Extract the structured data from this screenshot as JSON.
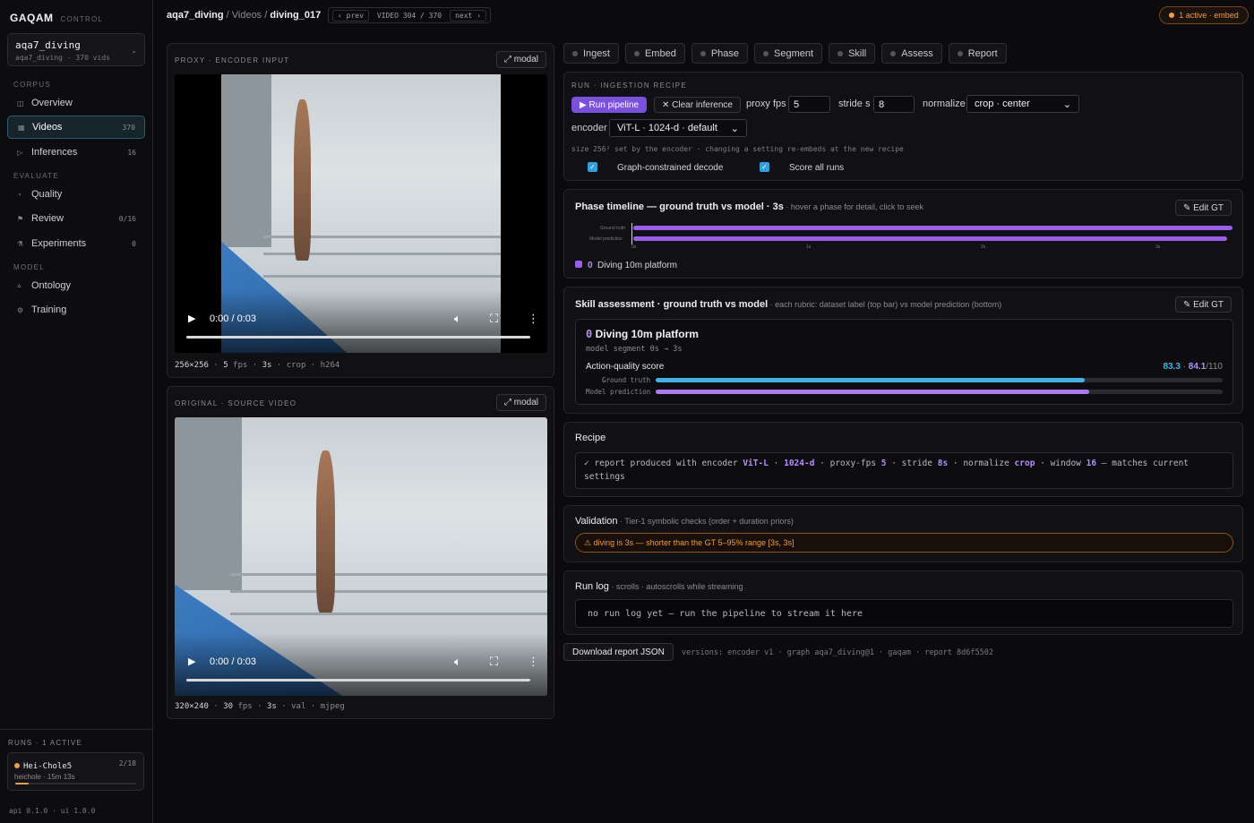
{
  "brand": {
    "name": "GAQAM",
    "sub": "CONTROL"
  },
  "dataset": {
    "name": "aqa7_diving",
    "meta": "aqa7_diving · 370 vids",
    "caret": "⌄"
  },
  "nav": {
    "corpus_label": "CORPUS",
    "evaluate_label": "EVALUATE",
    "model_label": "MODEL",
    "overview": {
      "label": "Overview",
      "icon": "◫"
    },
    "videos": {
      "label": "Videos",
      "count": "370",
      "icon": "▦"
    },
    "inferences": {
      "label": "Inferences",
      "count": "16",
      "icon": "▷"
    },
    "quality": {
      "label": "Quality",
      "icon": "◔"
    },
    "review": {
      "label": "Review",
      "count": "0/16",
      "icon": "⚑"
    },
    "experiments": {
      "label": "Experiments",
      "count": "0",
      "icon": "⚗"
    },
    "ontology": {
      "label": "Ontology",
      "icon": "⟑"
    },
    "training": {
      "label": "Training",
      "icon": "⚙"
    }
  },
  "runs": {
    "header": "RUNS · 1 ACTIVE",
    "item": {
      "name": "Hei-Chole5",
      "count": "2/18",
      "sub": "heichole · 15m 13s",
      "progress": 0.11
    }
  },
  "api_version": "api 0.1.0 · ui 1.0.0",
  "breadcrumb": {
    "dataset": "aqa7_diving",
    "sep1": " / ",
    "section": "Videos",
    "sep2": " / ",
    "item": "diving_017"
  },
  "video_nav": {
    "prev": "‹ prev",
    "position": "VIDEO 304 / 370",
    "next": "next ›"
  },
  "active_badge": "1 active · embed",
  "proxy_panel": {
    "label": "PROXY · ENCODER INPUT",
    "modal_label": "⤢ modal",
    "time": "0:00 / 0:03",
    "meta": {
      "res": "256×256",
      "fps": "5",
      "fps_unit": "fps",
      "dur": "3s",
      "mode": "crop",
      "codec": "h264"
    }
  },
  "source_panel": {
    "label": "ORIGINAL · SOURCE VIDEO",
    "modal_label": "⤢ modal",
    "time": "0:00 / 0:03",
    "meta": {
      "res": "320×240",
      "fps": "30",
      "fps_unit": "fps",
      "dur": "3s",
      "split": "val",
      "codec": "mjpeg"
    }
  },
  "tabs": [
    "Ingest",
    "Embed",
    "Phase",
    "Segment",
    "Skill",
    "Assess",
    "Report"
  ],
  "run": {
    "label": "RUN · INGESTION RECIPE",
    "run_button": "▶ Run pipeline",
    "clear_button": "✕ Clear inference",
    "proxy_fps_label": "proxy fps",
    "proxy_fps_value": "5",
    "stride_label": "stride s",
    "stride_value": "8",
    "normalize_label": "normalize",
    "normalize_value": "crop · center",
    "encoder_label": "encoder",
    "encoder_value": "ViT-L · 1024-d · default",
    "hint": "size 256² set by the encoder · changing a setting re-embeds at the new recipe",
    "graph_decode_label": "Graph-constrained decode",
    "score_all_label": "Score all runs"
  },
  "phase": {
    "title": "Phase timeline — ground truth vs model · 3s",
    "subtitle": " · hover a phase for detail, click to seek",
    "edit_label": "✎ Edit GT",
    "gt_label": "Ground truth",
    "model_label": "Model prediction",
    "ticks": [
      "0s",
      "1s",
      "2s",
      "3s"
    ],
    "legend_id": "0",
    "legend_label": "Diving 10m platform"
  },
  "skill": {
    "title": "Skill assessment · ground truth vs model",
    "subtitle": " · each rubric: dataset label (top bar) vs model prediction (bottom)",
    "edit_label": "✎ Edit GT",
    "card_id": "0",
    "card_title": "Diving 10m platform",
    "segment": "model segment 0s → 3s",
    "metric": "Action-quality score",
    "gt_score": "83.3",
    "model_score": "84.1",
    "max": "/110",
    "gt_label": "Ground truth",
    "model_label": "Model prediction",
    "gt_value": 83.3,
    "model_value": 84.1,
    "max_value": 110
  },
  "recipe": {
    "title": "Recipe",
    "p1": "✓ report produced with encoder ",
    "encoder": "ViT-L",
    "p2": " · ",
    "dim": "1024-d",
    "p3": " · proxy-fps ",
    "fps": "5",
    "p4": " · stride ",
    "stride": "8s",
    "p5": " · normalize ",
    "normalize": "crop",
    "p6": " · window ",
    "window": "16",
    "p7": " — matches current settings"
  },
  "validation": {
    "title": "Validation",
    "subtitle": " · Tier-1 symbolic checks (order + duration priors)",
    "warning": "⚠ diving is 3s — shorter than the GT 5–95% range [3s, 3s]"
  },
  "runlog": {
    "title": "Run log",
    "subtitle": " · scrolls · autoscrolls while streaming",
    "body": "no run log yet — run the pipeline to stream it here"
  },
  "footer": {
    "download": "Download report JSON",
    "versions": "versions: encoder v1 · graph aqa7_diving@1 · gaqam · report 8d6f5502"
  },
  "colors": {
    "accent": "#7b4fe0",
    "active": "#f39c3d",
    "gt_bar": "#3fb3e6",
    "model_bar": "#a77af2"
  }
}
